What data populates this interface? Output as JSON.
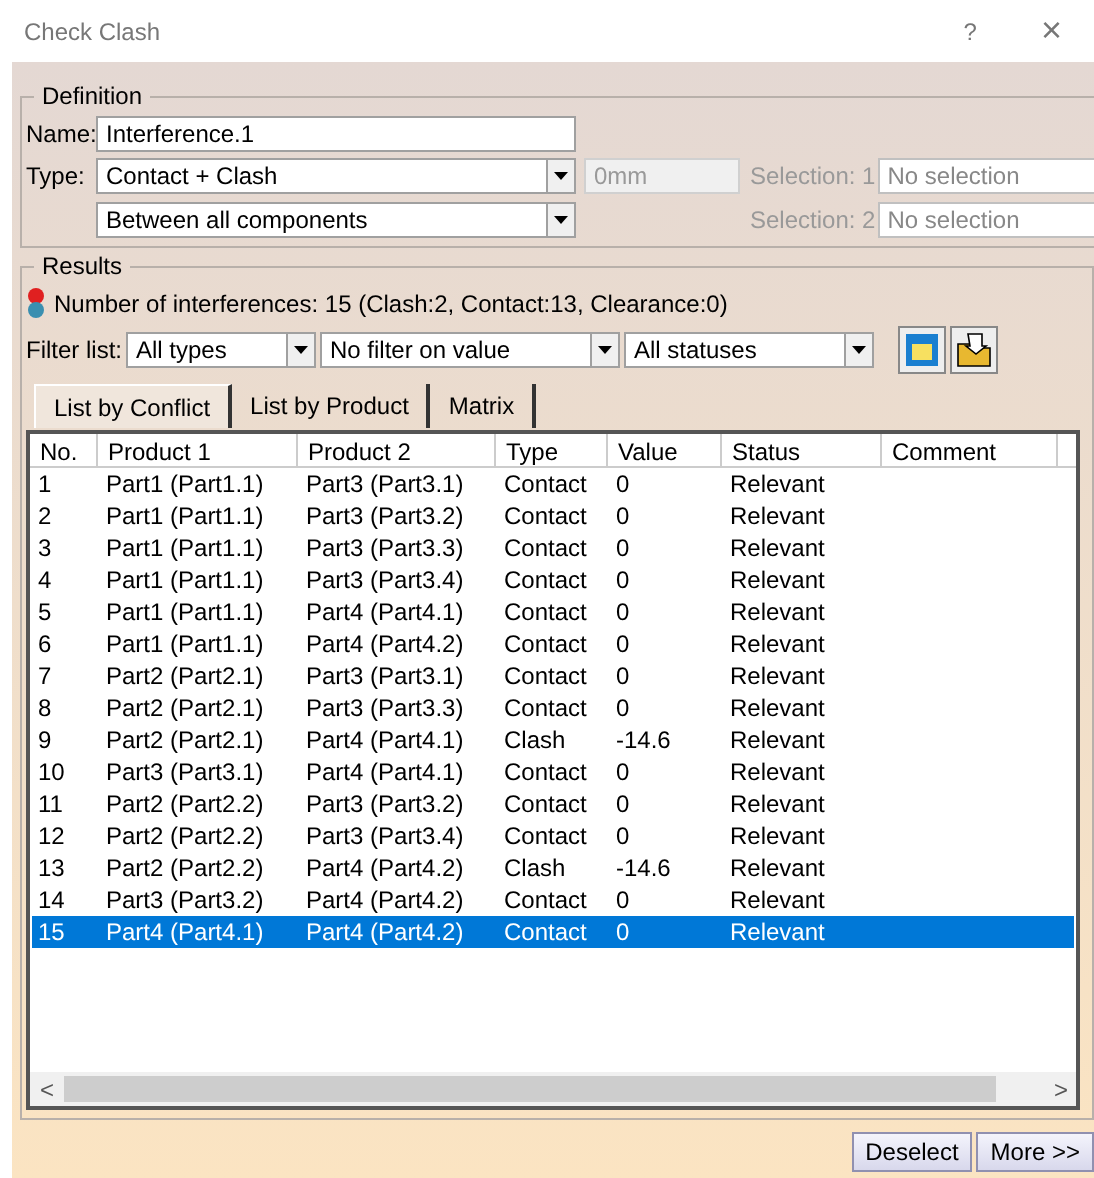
{
  "window": {
    "title": "Check Clash",
    "help": "?",
    "close": "×"
  },
  "definition": {
    "title": "Definition",
    "name_label": "Name:",
    "name_value": "Interference.1",
    "type_label": "Type:",
    "type_value": "Contact + Clash",
    "clearance_value": "0mm",
    "scope_value": "Between all components",
    "selections": [
      {
        "label": "Selection: 1",
        "placeholder": "No selection"
      },
      {
        "label": "Selection: 2",
        "placeholder": "No selection"
      }
    ]
  },
  "results": {
    "title": "Results",
    "summary": "Number of interferences: 15 (Clash:2, Contact:13, Clearance:0)",
    "filter_label": "Filter list:",
    "filters": [
      {
        "value": "All types"
      },
      {
        "value": "No filter on value"
      },
      {
        "value": "All statuses"
      }
    ],
    "tabs": [
      {
        "label": "List by Conflict",
        "selected": true
      },
      {
        "label": "List by Product",
        "selected": false
      },
      {
        "label": "Matrix",
        "selected": false
      }
    ],
    "table": {
      "columns": [
        "No.",
        "Product 1",
        "Product 2",
        "Type",
        "Value",
        "Status",
        "Comment"
      ],
      "rows": [
        {
          "cells": [
            "1",
            "Part1 (Part1.1)",
            "Part3 (Part3.1)",
            "Contact",
            "0",
            "Relevant"
          ],
          "selected": false
        },
        {
          "cells": [
            "2",
            "Part1 (Part1.1)",
            "Part3 (Part3.2)",
            "Contact",
            "0",
            "Relevant"
          ],
          "selected": false
        },
        {
          "cells": [
            "3",
            "Part1 (Part1.1)",
            "Part3 (Part3.3)",
            "Contact",
            "0",
            "Relevant"
          ],
          "selected": false
        },
        {
          "cells": [
            "4",
            "Part1 (Part1.1)",
            "Part3 (Part3.4)",
            "Contact",
            "0",
            "Relevant"
          ],
          "selected": false
        },
        {
          "cells": [
            "5",
            "Part1 (Part1.1)",
            "Part4 (Part4.1)",
            "Contact",
            "0",
            "Relevant"
          ],
          "selected": false
        },
        {
          "cells": [
            "6",
            "Part1 (Part1.1)",
            "Part4 (Part4.2)",
            "Contact",
            "0",
            "Relevant"
          ],
          "selected": false
        },
        {
          "cells": [
            "7",
            "Part2 (Part2.1)",
            "Part3 (Part3.1)",
            "Contact",
            "0",
            "Relevant"
          ],
          "selected": false
        },
        {
          "cells": [
            "8",
            "Part2 (Part2.1)",
            "Part3 (Part3.3)",
            "Contact",
            "0",
            "Relevant"
          ],
          "selected": false
        },
        {
          "cells": [
            "9",
            "Part2 (Part2.1)",
            "Part4 (Part4.1)",
            "Clash",
            "-14.6",
            "Relevant"
          ],
          "selected": false
        },
        {
          "cells": [
            "10",
            "Part3 (Part3.1)",
            "Part4 (Part4.1)",
            "Contact",
            "0",
            "Relevant"
          ],
          "selected": false
        },
        {
          "cells": [
            "11",
            "Part2 (Part2.2)",
            "Part3 (Part3.2)",
            "Contact",
            "0",
            "Relevant"
          ],
          "selected": false
        },
        {
          "cells": [
            "12",
            "Part2 (Part2.2)",
            "Part3 (Part3.4)",
            "Contact",
            "0",
            "Relevant"
          ],
          "selected": false
        },
        {
          "cells": [
            "13",
            "Part2 (Part2.2)",
            "Part4 (Part4.2)",
            "Clash",
            "-14.6",
            "Relevant"
          ],
          "selected": false
        },
        {
          "cells": [
            "14",
            "Part3 (Part3.2)",
            "Part4 (Part4.2)",
            "Contact",
            "0",
            "Relevant"
          ],
          "selected": false
        },
        {
          "cells": [
            "15",
            "Part4 (Part4.1)",
            "Part4 (Part4.2)",
            "Contact",
            "0",
            "Relevant"
          ],
          "selected": true
        }
      ]
    },
    "scroll_left": "<",
    "scroll_right": ">"
  },
  "buttons": [
    "Deselect",
    "More >>"
  ]
}
